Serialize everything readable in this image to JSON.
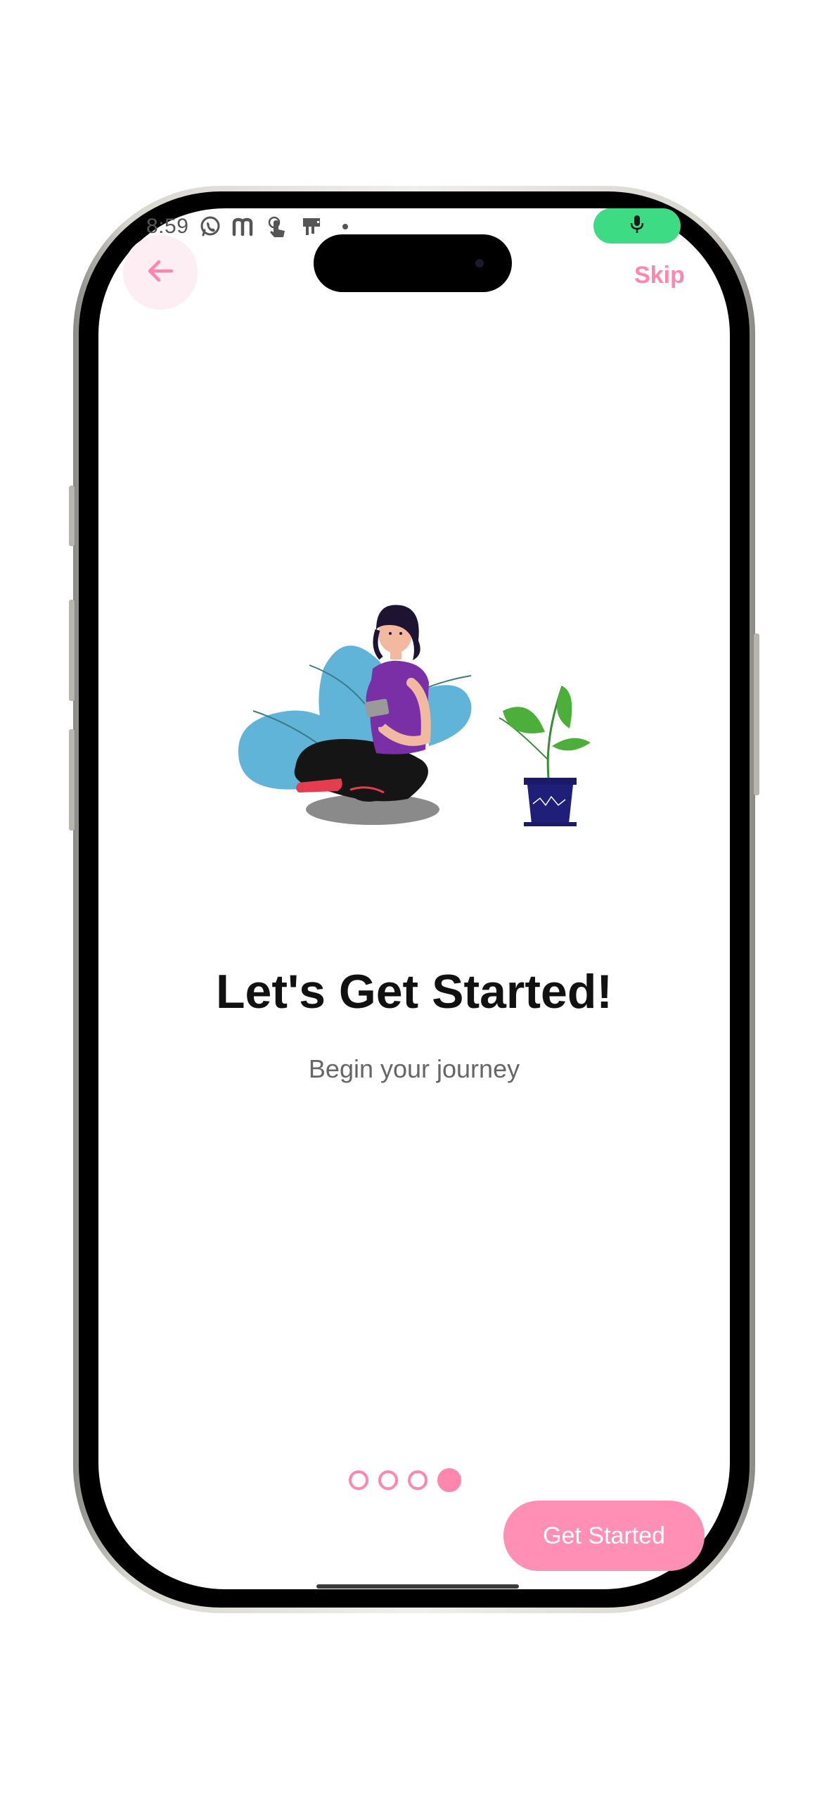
{
  "status_bar": {
    "time": "8:59",
    "icons": [
      "whatsapp-icon",
      "m-app-icon",
      "touch-icon",
      "sim-icon",
      "dot-icon"
    ],
    "mic_color": "#3ddc84"
  },
  "header": {
    "back_icon": "arrow-left-icon",
    "skip_label": "Skip"
  },
  "onboarding": {
    "illustration": "woman-with-phone-and-plant-illustration",
    "title": "Let's Get Started!",
    "subtitle": "Begin your journey",
    "page_count": 4,
    "current_page": 4,
    "cta_label": "Get Started"
  },
  "colors": {
    "accent": "#ff86ad",
    "cta_bg": "#ff8fb4",
    "back_bg": "#fdeef3"
  }
}
